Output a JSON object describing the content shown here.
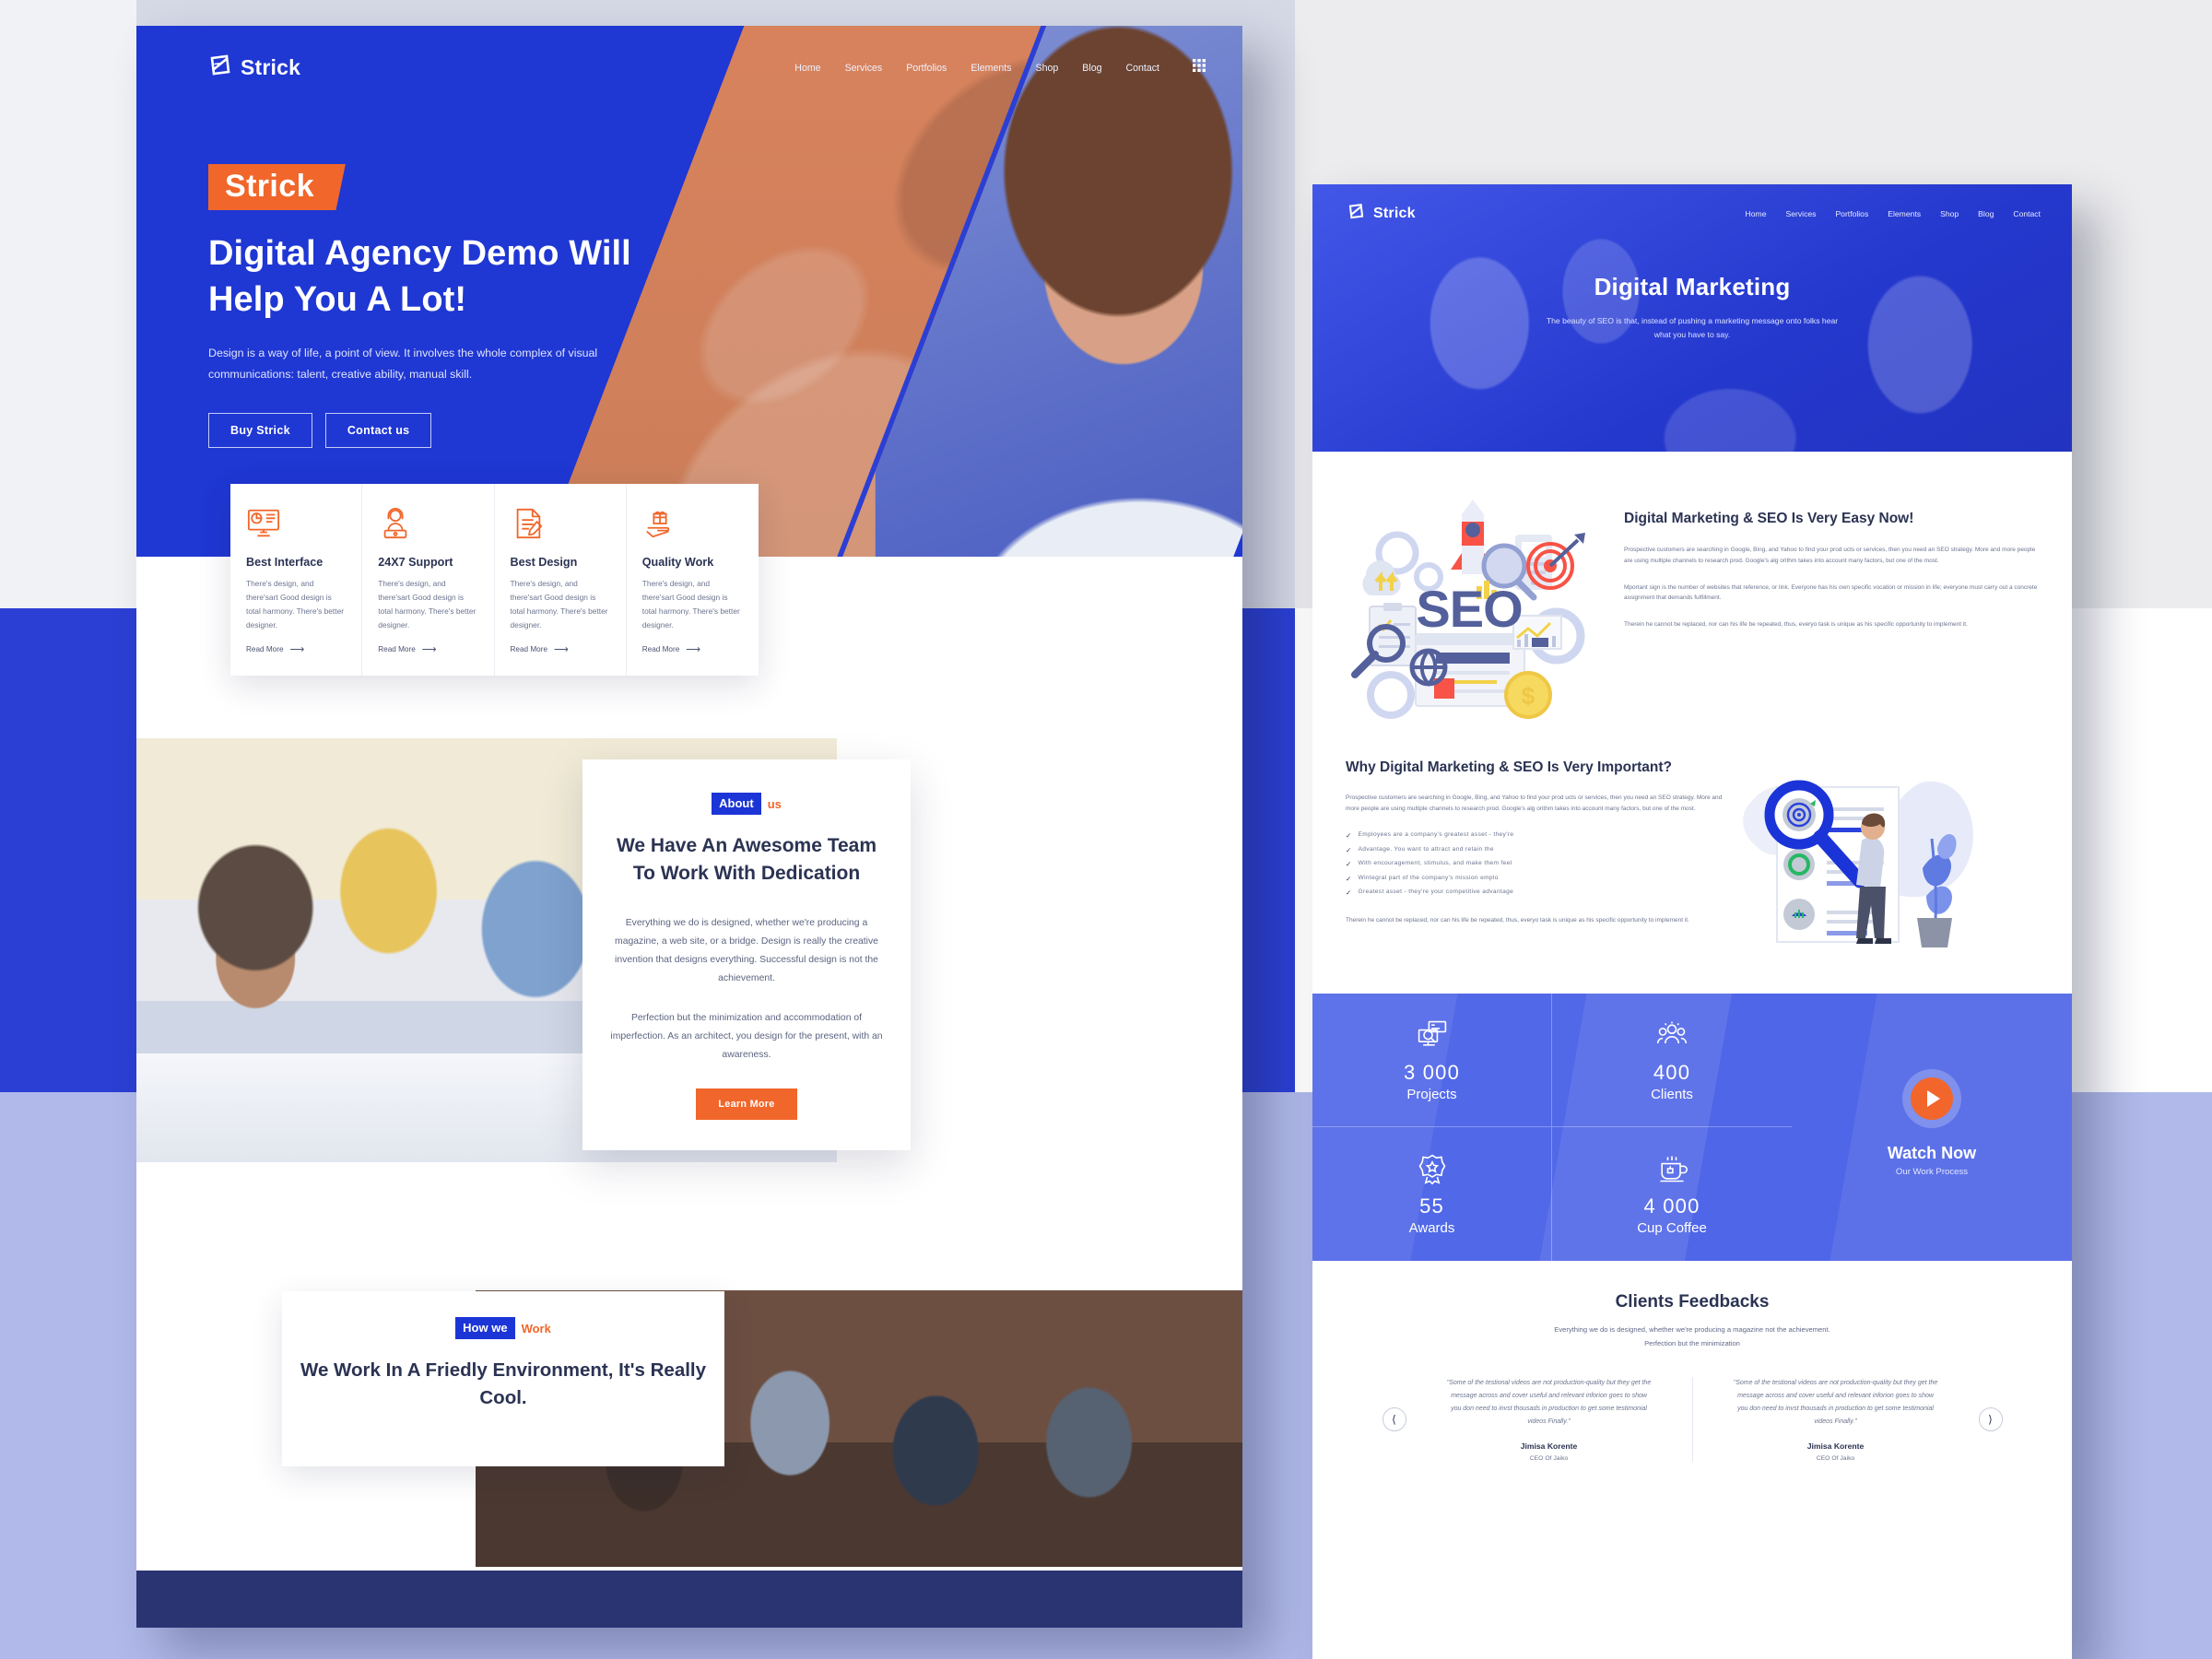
{
  "brand": {
    "name": "Strick",
    "logo_icon": "strick-logo-icon"
  },
  "left_page": {
    "nav": {
      "items": [
        "Home",
        "Services",
        "Portfolios",
        "Elements",
        "Shop",
        "Blog",
        "Contact"
      ],
      "menu_icon": "grid-menu-icon"
    },
    "hero": {
      "tag": "Strick",
      "heading_line1": "Digital Agency Demo Will",
      "heading_line2": "Help You A Lot!",
      "paragraph": "Design is a way of life, a point of view. It involves the whole complex of visual communications: talent, creative ability, manual skill.",
      "primary_button": "Buy Strick",
      "secondary_button": "Contact us"
    },
    "features": [
      {
        "icon": "monitor-chart-icon",
        "title": "Best Interface",
        "text": "There's design, and there'sart Good design is total harmony. There's better designer.",
        "link": "Read More"
      },
      {
        "icon": "headset-support-icon",
        "title": "24X7 Support",
        "text": "There's design, and there'sart Good design is total harmony. There's better designer.",
        "link": "Read More"
      },
      {
        "icon": "document-pencil-icon",
        "title": "Best Design",
        "text": "There's design, and there'sart Good design is total harmony. There's better designer.",
        "link": "Read More"
      },
      {
        "icon": "hand-gift-diamond-icon",
        "title": "Quality Work",
        "text": "There's design, and there'sart Good design is total harmony. There's better designer.",
        "link": "Read More"
      }
    ],
    "about": {
      "pill_bold": "About",
      "pill_accent": "us",
      "heading": "We Have An Awesome Team To Work With Dedication",
      "paragraph1": "Everything we do is designed, whether we're producing a magazine, a web site, or a bridge. Design is really the creative invention that designs everything. Successful design is not the achievement.",
      "paragraph2": "Perfection but the minimization and accommodation of imperfection. As an architect, you design for the present, with an awareness.",
      "button": "Learn More"
    },
    "work": {
      "pill_bold": "How we",
      "pill_accent": "Work",
      "heading": "We Work In A Friedly Environment, It's Really Cool."
    }
  },
  "right_page": {
    "nav": {
      "items": [
        "Home",
        "Services",
        "Portfolios",
        "Elements",
        "Shop",
        "Blog",
        "Contact"
      ]
    },
    "hero": {
      "title": "Digital Marketing",
      "subtitle": "The beauty of SEO is that, instead of pushing a marketing message onto folks hear what you have to say."
    },
    "seo": {
      "illustration": "seo-illustration",
      "heading": "Digital Marketing & SEO Is Very Easy Now!",
      "paragraph1": "Prospective customers are searching in Google, Bing, and Yahoo to find your prod ucts or services, then you need an SEO strategy. More and more people are using multiple channels to research prod. Google's alg orithm takes into account many factors, but one of the most.",
      "paragraph2": "Mportant sign is the number of websites that reference, or link. Everyone has his own specific vocation or mission in life; everyone must carry out a concrete assignment that demands fulfillment.",
      "paragraph3": "Therein he cannot be replaced, nor can his life be repeated, thus, everyo task is unique as his specific opportunity to implement it."
    },
    "why": {
      "heading": "Why Digital Marketing & SEO Is Very Important?",
      "lead": "Prospective customers are searching in Google, Bing, and Yahoo to find your prod ucts or services, then you need an SEO strategy. More and more people are using multiple channels to research prod. Google's alg orithm takes into account many factors, but one of the most.",
      "checklist": [
        "Employees are a company's greatest asset - they're",
        "Advantage. You want to attract and retain the",
        "With encouragement, stimulus, and make them feel",
        "Wintegral part of the company's mission emplo",
        "Greatest asset - they're your competitive advantage"
      ],
      "tail": "Therein he cannot be replaced, nor can his life be repeated, thus, everyo task is unique as his specific opportunity to implement it.",
      "illustration": "magnifier-document-person-illustration"
    },
    "counters": [
      {
        "icon": "presentation-search-icon",
        "number": "3 000",
        "label": "Projects"
      },
      {
        "icon": "people-group-icon",
        "number": "400",
        "label": "Clients"
      },
      {
        "icon": "award-badge-icon",
        "number": "55",
        "label": "Awards"
      },
      {
        "icon": "coffee-cup-icon",
        "number": "4 000",
        "label": "Cup Coffee"
      }
    ],
    "watch": {
      "play_icon": "play-button-icon",
      "title": "Watch Now",
      "subtitle": "Our Work Process"
    },
    "testimonials": {
      "heading": "Clients Feedbacks",
      "subtitle": "Everything we do is designed, whether we're producing a magazine not the achievement. Perfection but the minimization",
      "prev_icon": "chevron-left-icon",
      "next_icon": "chevron-right-icon",
      "items": [
        {
          "quote": "\"Some of the testional videos are not production-quality but they get the message across and cover useful and relevant inforion goes to show you don need to invst thousads in production to get some testimonial videos Finally.\"",
          "name": "Jimisa Korente",
          "role": "CEO Of Jaiko"
        },
        {
          "quote": "\"Some of the testional videos are not production-quality but they get the message across and cover useful and relevant inforion goes to show you don need to invst thousads in production to get some testimonial videos Finally.\"",
          "name": "Jimisa Korente",
          "role": "CEO Of Jaiko"
        }
      ]
    }
  },
  "colors": {
    "brand_blue": "#1f37d3",
    "accent_orange": "#f1662a",
    "dark_navy": "#2b3353",
    "band_blue": "#2b3fd4",
    "band_lavender": "#b0b9ea"
  }
}
